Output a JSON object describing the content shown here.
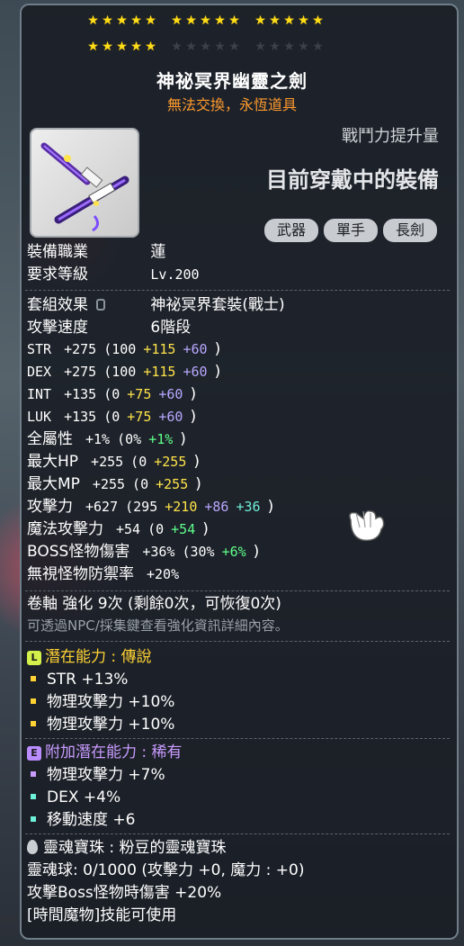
{
  "stars": {
    "row1": [
      [
        true,
        true,
        true,
        true,
        true
      ],
      [
        true,
        true,
        true,
        true,
        true
      ],
      [
        true,
        true,
        true,
        true,
        true
      ]
    ],
    "row2": [
      [
        true,
        true,
        true,
        true,
        true
      ],
      [
        false,
        false,
        false,
        false,
        false
      ],
      [
        false,
        false,
        false,
        false,
        false
      ]
    ]
  },
  "item": {
    "name": "神祕冥界幽靈之劍",
    "trade_flag": "無法交換，永恆道具",
    "combat_label": "戰鬥力提升量",
    "equipped_label": "目前穿戴中的裝備",
    "tags": [
      "武器",
      "單手",
      "長劍"
    ]
  },
  "requirements": {
    "job_label": "裝備職業",
    "job_value": "蓮",
    "level_label": "要求等級",
    "level_value": "Lv.200"
  },
  "set_effect": {
    "label": "套組效果",
    "value": "神祕冥界套裝(戰士)"
  },
  "attack_speed": {
    "label": "攻擊速度",
    "value": "6階段"
  },
  "stats": [
    {
      "name": "STR",
      "total": "+275",
      "base": "(100",
      "flame": "+115",
      "star": "+60",
      "close": ")"
    },
    {
      "name": "DEX",
      "total": "+275",
      "base": "(100",
      "flame": "+115",
      "star": "+60",
      "close": ")"
    },
    {
      "name": "INT",
      "total": "+135",
      "base": "(0",
      "flame": "+75",
      "star": "+60",
      "close": ")"
    },
    {
      "name": "LUK",
      "total": "+135",
      "base": "(0",
      "flame": "+75",
      "star": "+60",
      "close": ")"
    },
    {
      "name": "全屬性",
      "total": "+1%",
      "base": "(0%",
      "flame": "+1%",
      "close": ")"
    },
    {
      "name": "最大HP",
      "total": "+255",
      "base": "(0",
      "flame": "+255",
      "close": ")"
    },
    {
      "name": "最大MP",
      "total": "+255",
      "base": "(0",
      "flame": "+255",
      "close": ")"
    },
    {
      "name": "攻擊力",
      "total": "+627",
      "base": "(295",
      "flame": "+210",
      "star": "+86",
      "extra": "+36",
      "close": ")"
    },
    {
      "name": "魔法攻擊力",
      "total": "+54",
      "base": "(0",
      "flame": "+54",
      "close": ")"
    },
    {
      "name": "BOSS怪物傷害",
      "total": "+36%",
      "base": "(30%",
      "flame": "+6%",
      "close": ")"
    },
    {
      "name": "無視怪物防禦率",
      "total": "+20%"
    }
  ],
  "scroll": {
    "line": "卷軸 強化 9次 (剩餘0次，可恢復0次)",
    "hint": "可透過NPC/採集鍵查看強化資訊詳細內容。"
  },
  "potential": {
    "badge": "L",
    "title": "潛在能力 : 傳說",
    "lines": [
      "STR +13%",
      "物理攻擊力 +10%",
      "物理攻擊力 +10%"
    ]
  },
  "additional": {
    "badge": "E",
    "title": "附加潛在能力 : 稀有",
    "lines": [
      "物理攻擊力 +7%",
      "DEX +4%",
      "移動速度 +6"
    ]
  },
  "soul": {
    "title": "靈魂寶珠 : 粉豆的靈魂寶珠",
    "orb": "靈魂球: 0/1000 (攻擊力 +0, 魔力 : +0)",
    "boss": "攻擊Boss怪物時傷害 +20%",
    "skill": "[時間魔物]技能可使用"
  },
  "colors": {
    "star_on": "#ffde17",
    "flame": "#ffe34a",
    "star_force": "#b8a8ff",
    "bonus": "#5eff8a",
    "legendary": "#ffd234",
    "rare": "#c99bff",
    "untradeable": "#ff9a2e"
  }
}
